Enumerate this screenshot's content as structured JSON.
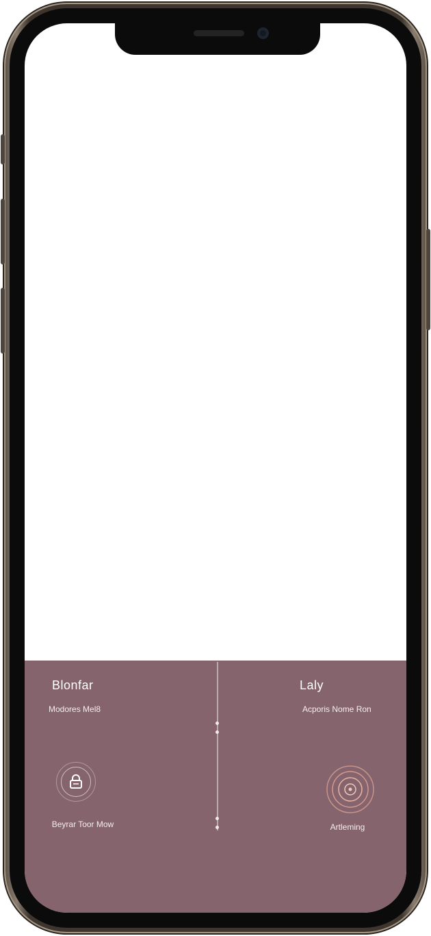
{
  "left_column": {
    "title": "Blonfar",
    "subtitle": "Modores Mel8",
    "icon": "lock-icon",
    "caption": "Beyrar Toor Mow"
  },
  "right_column": {
    "title": "Laly",
    "subtitle": "Acporis Nome Ron",
    "icon": "target-icon",
    "caption": "Artleming"
  },
  "colors": {
    "panel": "#85646d",
    "frame": "#3d352e",
    "text": "#ffffff"
  }
}
